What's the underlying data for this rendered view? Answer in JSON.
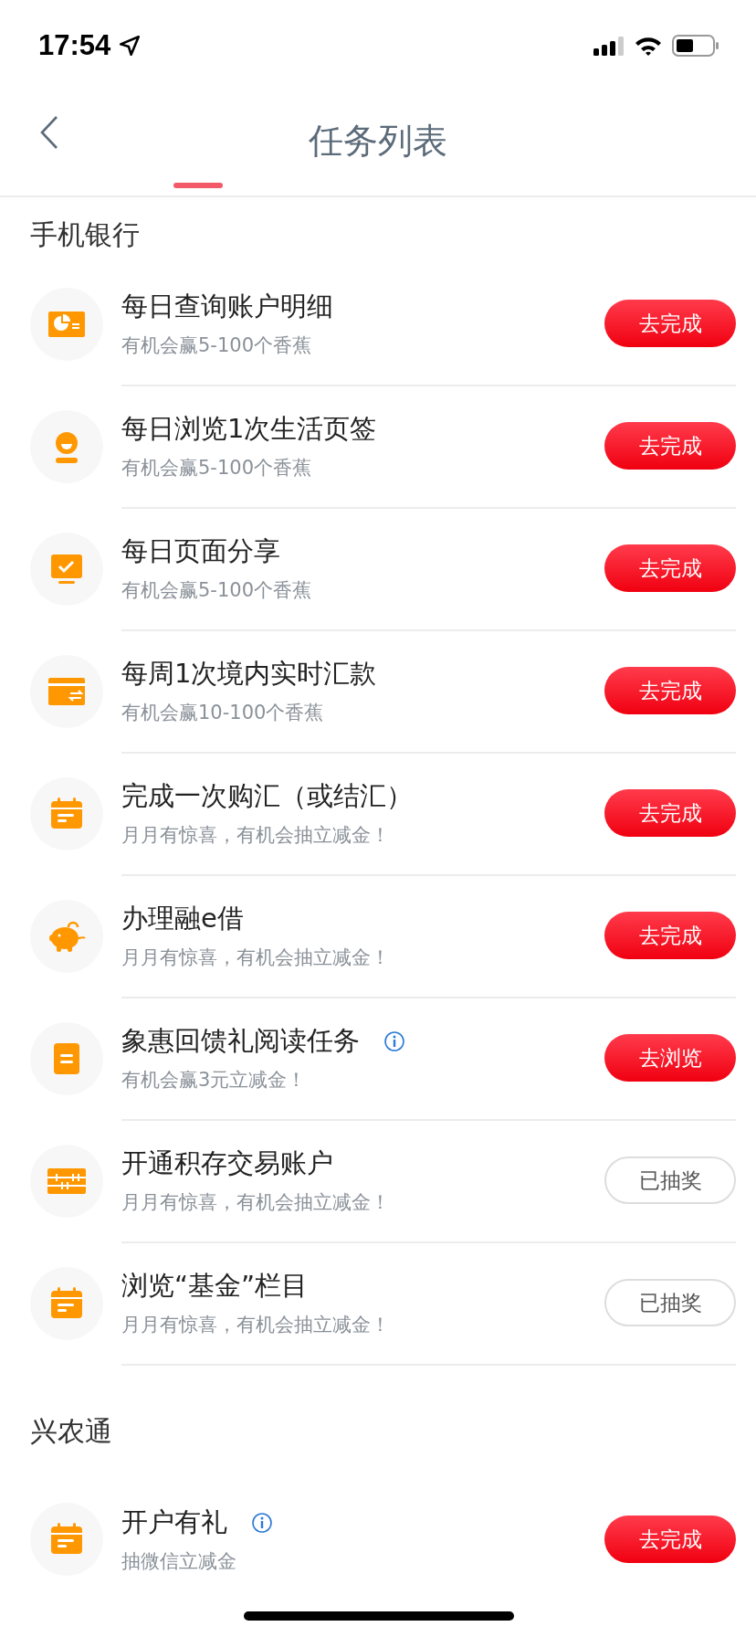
{
  "status_bar": {
    "time": "17:54"
  },
  "header": {
    "title": "任务列表"
  },
  "sections": [
    {
      "title": "手机银行",
      "tasks": [
        {
          "kind": "chart-card",
          "title": "每日查询账户明细",
          "info": false,
          "subtitle": "有机会赢5-100个香蕉",
          "button": {
            "label": "去完成",
            "kind": "action"
          }
        },
        {
          "kind": "person",
          "title": "每日浏览1次生活页签",
          "info": false,
          "subtitle": "有机会赢5-100个香蕉",
          "button": {
            "label": "去完成",
            "kind": "action"
          }
        },
        {
          "kind": "monitor-check",
          "title": "每日页面分享",
          "info": false,
          "subtitle": "有机会赢5-100个香蕉",
          "button": {
            "label": "去完成",
            "kind": "action"
          }
        },
        {
          "kind": "card-transfer",
          "title": "每周1次境内实时汇款",
          "info": false,
          "subtitle": "有机会赢10-100个香蕉",
          "button": {
            "label": "去完成",
            "kind": "action"
          }
        },
        {
          "kind": "calendar",
          "title": "完成一次购汇（或结汇）",
          "info": false,
          "subtitle": "月月有惊喜，有机会抽立减金！",
          "button": {
            "label": "去完成",
            "kind": "action"
          }
        },
        {
          "kind": "piggy",
          "title": "办理融e借",
          "info": false,
          "subtitle": "月月有惊喜，有机会抽立减金！",
          "button": {
            "label": "去完成",
            "kind": "action"
          }
        },
        {
          "kind": "document",
          "title": "象惠回馈礼阅读任务",
          "info": true,
          "subtitle": "有机会赢3元立减金！",
          "button": {
            "label": "去浏览",
            "kind": "action"
          }
        },
        {
          "kind": "abacus",
          "title": "开通积存交易账户",
          "info": false,
          "subtitle": "月月有惊喜，有机会抽立减金！",
          "button": {
            "label": "已抽奖",
            "kind": "done"
          }
        },
        {
          "kind": "calendar",
          "title": "浏览“基金”栏目",
          "info": false,
          "subtitle": "月月有惊喜，有机会抽立减金！",
          "button": {
            "label": "已抽奖",
            "kind": "done"
          }
        }
      ]
    },
    {
      "title": "兴农通",
      "tasks": [
        {
          "kind": "calendar",
          "title": "开户有礼",
          "info": true,
          "subtitle": "抽微信立减金",
          "button": {
            "label": "去完成",
            "kind": "action"
          }
        }
      ]
    }
  ]
}
